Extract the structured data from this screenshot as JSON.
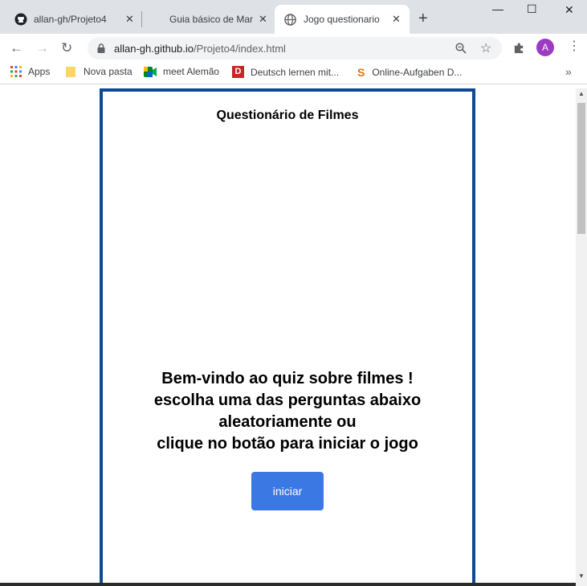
{
  "browser": {
    "tabs": [
      {
        "title": "allan-gh/Projeto4",
        "icon": "github-icon"
      },
      {
        "title": "Guia básico de Mar",
        "icon": ""
      },
      {
        "title": "Jogo questionario",
        "icon": "globe-icon",
        "active": true
      }
    ],
    "url_host": "allan-gh.github.io",
    "url_path": "/Projeto4/index.html",
    "profile_initial": "A",
    "bookmarks": [
      {
        "label": "Apps",
        "icon": "apps-grid-icon"
      },
      {
        "label": "Nova pasta",
        "icon": "folder-icon"
      },
      {
        "label": "meet Alemão",
        "icon": "meet-icon"
      },
      {
        "label": "Deutsch lernen mit...",
        "icon": "d-logo-icon"
      },
      {
        "label": "Online-Aufgaben D...",
        "icon": "s-logo-icon"
      }
    ]
  },
  "quiz": {
    "title": "Questionário de Filmes",
    "welcome_lines": [
      "Bem-vindo ao quiz sobre filmes !",
      "escolha uma das perguntas abaixo",
      "aleatoriamente ou",
      "clique no botão para iniciar o jogo"
    ],
    "start_label": "iniciar"
  },
  "colors": {
    "border": "#0d4a94",
    "button": "#3c78e4"
  }
}
